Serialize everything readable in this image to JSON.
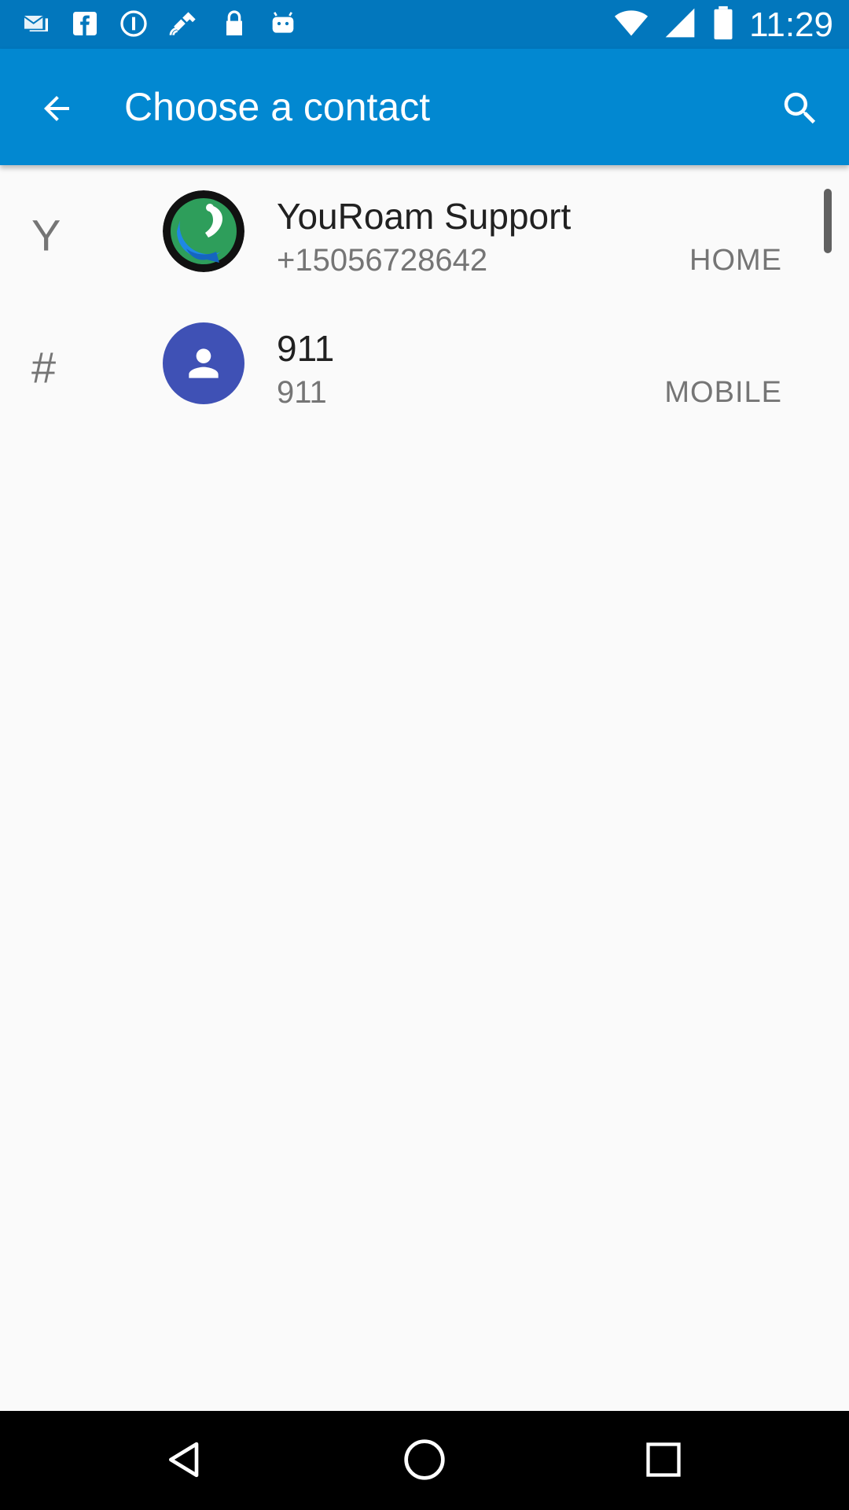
{
  "status_bar": {
    "time": "11:29",
    "left_icons": [
      "email-icon",
      "facebook-icon",
      "info-icon",
      "satellite-icon",
      "lock-icon",
      "android-icon"
    ],
    "right_icons": [
      "wifi-icon",
      "signal-icon",
      "battery-icon"
    ]
  },
  "app_bar": {
    "title": "Choose a contact",
    "back_icon": "arrow-back-icon",
    "search_icon": "search-icon",
    "background": "#0288d1",
    "status_background": "#0277bd"
  },
  "contacts": [
    {
      "section": "Y",
      "name": "YouRoam Support",
      "number": "+15056728642",
      "type": "HOME",
      "avatar": "youroam-logo-icon"
    },
    {
      "section": "#",
      "name": "911",
      "number": "911",
      "type": "MOBILE",
      "avatar": "person-icon",
      "avatar_color": "#3f51b5"
    }
  ],
  "nav_bar": {
    "back": "nav-back-icon",
    "home": "nav-home-icon",
    "recents": "nav-recents-icon"
  }
}
